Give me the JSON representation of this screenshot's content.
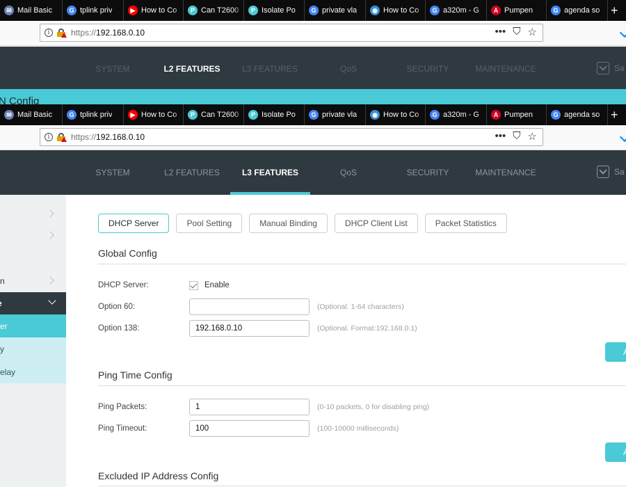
{
  "browser": {
    "tabs": [
      {
        "title": "Mail Basic",
        "icon": "mail-icon",
        "color": "#6b7fb0"
      },
      {
        "title": "tplink priv",
        "icon": "google-icon",
        "color": "#4285f4"
      },
      {
        "title": "How to Co",
        "icon": "youtube-icon",
        "color": "#ff0000"
      },
      {
        "title": "Can T2600",
        "icon": "tplink-icon",
        "color": "#4ac9d6"
      },
      {
        "title": "Isolate Po",
        "icon": "tplink-icon",
        "color": "#4ac9d6"
      },
      {
        "title": "private vla",
        "icon": "google-icon",
        "color": "#4285f4"
      },
      {
        "title": "How to Co",
        "icon": "site-icon",
        "color": "#3a8fd6"
      },
      {
        "title": "a320m - G",
        "icon": "google-icon",
        "color": "#4285f4"
      },
      {
        "title": "Pumpen",
        "icon": "pdf-icon",
        "color": "#d70022"
      },
      {
        "title": "agenda so",
        "icon": "google-icon",
        "color": "#4285f4"
      }
    ],
    "url_prefix": "https://",
    "url_host": "192.168.0.10",
    "menu_glyph": "•••",
    "pocket_glyph": "⛉",
    "star_glyph": "☆"
  },
  "app": {
    "nav": [
      "SYSTEM",
      "L2 FEATURES",
      "L3 FEATURES",
      "QoS",
      "SECURITY",
      "MAINTENANCE"
    ],
    "save_label": "Sa",
    "back_title": "AN Config",
    "accent": "#4ac9d6"
  },
  "sidebar": {
    "rows": [
      "",
      "",
      "",
      "n",
      "e"
    ],
    "subs": [
      "er",
      "y",
      "elay"
    ]
  },
  "dhcp": {
    "tabs": [
      "DHCP Server",
      "Pool Setting",
      "Manual Binding",
      "DHCP Client List",
      "Packet Statistics"
    ],
    "global": {
      "title": "Global Config",
      "server_label": "DHCP Server:",
      "enable_label": "Enable",
      "opt60_label": "Option 60:",
      "opt60_value": "",
      "opt60_hint": "(Optional. 1-64 characters)",
      "opt138_label": "Option 138:",
      "opt138_value": "192.168.0.10",
      "opt138_hint": "(Optional. Format:192.168.0.1)",
      "apply_label": "A"
    },
    "ping": {
      "title": "Ping Time Config",
      "packets_label": "Ping Packets:",
      "packets_value": "1",
      "packets_hint": "(0-10 packets, 0 for disabling ping)",
      "timeout_label": "Ping Timeout:",
      "timeout_value": "100",
      "timeout_hint": "(100-10000 milliseconds)",
      "apply_label": "A"
    },
    "excluded_title": "Excluded IP Address Config"
  }
}
